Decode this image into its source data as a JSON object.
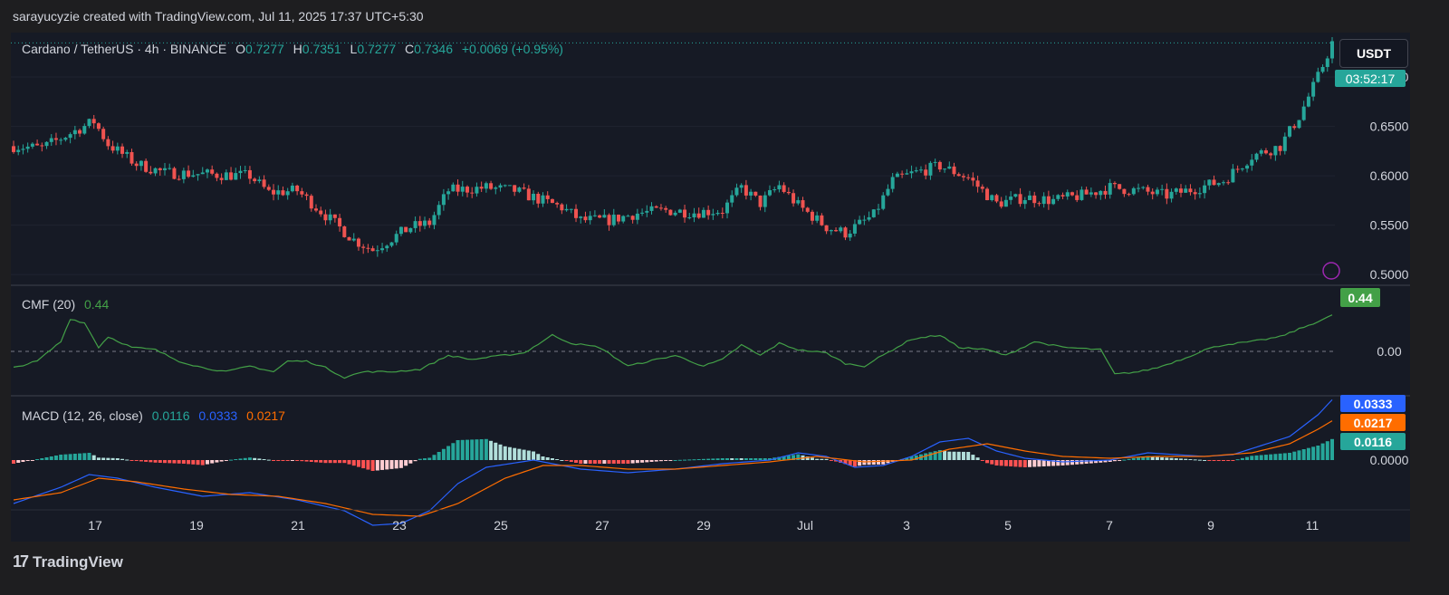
{
  "header": {
    "text": "sarayucyzie created with TradingView.com, Jul 11, 2025 17:37 UTC+5:30"
  },
  "footer": {
    "brand": "TradingView",
    "logo": "tv-logo-icon"
  },
  "symbol": {
    "name": "Cardano / TetherUS · 4h · BINANCE",
    "o_label": "O",
    "o": "0.7277",
    "h_label": "H",
    "h": "0.7351",
    "l_label": "L",
    "l": "0.7277",
    "c_label": "C",
    "c": "0.7346",
    "change": "+0.0069 (+0.95%)"
  },
  "currency_button": "USDT",
  "countdown": "03:52:17",
  "cmf": {
    "title": "CMF (20)",
    "value": "0.44"
  },
  "macd": {
    "title": "MACD (12, 26, close)",
    "histogram": "0.0116",
    "macd": "0.0333",
    "signal": "0.0217"
  },
  "colors": {
    "bg": "#161a25",
    "up": "#26a69a",
    "down": "#ef5350",
    "cmf": "#43a047",
    "macd": "#2962ff",
    "signal": "#ff6d00",
    "hist_up_strong": "#26a69a",
    "hist_up_weak": "#b2dfdb",
    "hist_down_strong": "#ff5252",
    "hist_down_weak": "#ffcdd2"
  },
  "chart_data": {
    "type": "candlestick",
    "price_axis": {
      "ticks": [
        "0.7000",
        "0.6500",
        "0.6000",
        "0.5500",
        "0.5000"
      ],
      "ylim": [
        0.49,
        0.745
      ]
    },
    "x_ticks": [
      "17",
      "19",
      "21",
      "23",
      "25",
      "27",
      "29",
      "Jul",
      "3",
      "5",
      "7",
      "9",
      "11"
    ],
    "last_price": 0.7346,
    "close_anchors": [
      [
        0,
        0.63
      ],
      [
        6,
        0.628
      ],
      [
        14,
        0.648
      ],
      [
        17,
        0.655
      ],
      [
        20,
        0.632
      ],
      [
        26,
        0.612
      ],
      [
        32,
        0.603
      ],
      [
        38,
        0.602
      ],
      [
        44,
        0.601
      ],
      [
        50,
        0.6
      ],
      [
        54,
        0.583
      ],
      [
        60,
        0.585
      ],
      [
        66,
        0.56
      ],
      [
        72,
        0.535
      ],
      [
        76,
        0.525
      ],
      [
        84,
        0.548
      ],
      [
        88,
        0.552
      ],
      [
        92,
        0.585
      ],
      [
        100,
        0.588
      ],
      [
        106,
        0.585
      ],
      [
        110,
        0.578
      ],
      [
        116,
        0.568
      ],
      [
        120,
        0.555
      ],
      [
        126,
        0.555
      ],
      [
        132,
        0.562
      ],
      [
        138,
        0.565
      ],
      [
        144,
        0.563
      ],
      [
        150,
        0.565
      ],
      [
        154,
        0.588
      ],
      [
        158,
        0.572
      ],
      [
        162,
        0.59
      ],
      [
        166,
        0.57
      ],
      [
        172,
        0.548
      ],
      [
        176,
        0.542
      ],
      [
        182,
        0.56
      ],
      [
        186,
        0.595
      ],
      [
        190,
        0.602
      ],
      [
        196,
        0.61
      ],
      [
        202,
        0.598
      ],
      [
        208,
        0.572
      ],
      [
        214,
        0.578
      ],
      [
        220,
        0.575
      ],
      [
        226,
        0.58
      ],
      [
        232,
        0.588
      ],
      [
        238,
        0.585
      ],
      [
        244,
        0.58
      ],
      [
        250,
        0.587
      ],
      [
        256,
        0.595
      ],
      [
        262,
        0.62
      ],
      [
        268,
        0.63
      ],
      [
        272,
        0.66
      ],
      [
        276,
        0.7
      ],
      [
        279,
        0.7346
      ]
    ],
    "cmf_series": {
      "name": "CMF (20)",
      "last": 0.44,
      "zero_line": 0,
      "anchors": [
        [
          0,
          -0.2
        ],
        [
          5,
          -0.12
        ],
        [
          10,
          0.12
        ],
        [
          12,
          0.4
        ],
        [
          15,
          0.35
        ],
        [
          18,
          0.05
        ],
        [
          20,
          0.18
        ],
        [
          25,
          0.05
        ],
        [
          30,
          0.02
        ],
        [
          35,
          -0.12
        ],
        [
          40,
          -0.2
        ],
        [
          45,
          -0.25
        ],
        [
          50,
          -0.18
        ],
        [
          55,
          -0.25
        ],
        [
          58,
          -0.12
        ],
        [
          62,
          -0.12
        ],
        [
          66,
          -0.2
        ],
        [
          70,
          -0.32
        ],
        [
          74,
          -0.25
        ],
        [
          80,
          -0.25
        ],
        [
          86,
          -0.22
        ],
        [
          92,
          -0.05
        ],
        [
          97,
          -0.1
        ],
        [
          102,
          -0.06
        ],
        [
          108,
          -0.02
        ],
        [
          114,
          0.2
        ],
        [
          118,
          0.1
        ],
        [
          124,
          0.05
        ],
        [
          130,
          -0.18
        ],
        [
          136,
          -0.1
        ],
        [
          140,
          -0.05
        ],
        [
          146,
          -0.18
        ],
        [
          150,
          -0.1
        ],
        [
          154,
          0.08
        ],
        [
          158,
          -0.05
        ],
        [
          162,
          0.1
        ],
        [
          166,
          0.02
        ],
        [
          172,
          -0.02
        ],
        [
          176,
          -0.15
        ],
        [
          180,
          -0.18
        ],
        [
          186,
          0.02
        ],
        [
          190,
          0.15
        ],
        [
          196,
          0.2
        ],
        [
          200,
          0.05
        ],
        [
          206,
          0.02
        ],
        [
          210,
          -0.05
        ],
        [
          216,
          0.12
        ],
        [
          222,
          0.05
        ],
        [
          230,
          0.02
        ],
        [
          233,
          -0.28
        ],
        [
          238,
          -0.25
        ],
        [
          242,
          -0.2
        ],
        [
          248,
          -0.08
        ],
        [
          252,
          0.02
        ],
        [
          256,
          0.08
        ],
        [
          262,
          0.12
        ],
        [
          268,
          0.18
        ],
        [
          274,
          0.32
        ],
        [
          279,
          0.44
        ]
      ]
    },
    "macd_series": {
      "macd_anchors": [
        [
          0,
          -0.024
        ],
        [
          10,
          -0.015
        ],
        [
          16,
          -0.008
        ],
        [
          22,
          -0.01
        ],
        [
          30,
          -0.015
        ],
        [
          40,
          -0.02
        ],
        [
          50,
          -0.018
        ],
        [
          60,
          -0.022
        ],
        [
          70,
          -0.028
        ],
        [
          76,
          -0.036
        ],
        [
          82,
          -0.035
        ],
        [
          88,
          -0.028
        ],
        [
          94,
          -0.013
        ],
        [
          100,
          -0.004
        ],
        [
          110,
          0.0
        ],
        [
          120,
          -0.005
        ],
        [
          130,
          -0.007
        ],
        [
          140,
          -0.005
        ],
        [
          150,
          -0.002
        ],
        [
          160,
          0.0
        ],
        [
          166,
          0.004
        ],
        [
          172,
          0.002
        ],
        [
          178,
          -0.004
        ],
        [
          184,
          -0.003
        ],
        [
          190,
          0.002
        ],
        [
          196,
          0.01
        ],
        [
          202,
          0.012
        ],
        [
          208,
          0.005
        ],
        [
          214,
          0.001
        ],
        [
          222,
          -0.001
        ],
        [
          232,
          0.0
        ],
        [
          240,
          0.004
        ],
        [
          246,
          0.003
        ],
        [
          252,
          0.002
        ],
        [
          258,
          0.003
        ],
        [
          264,
          0.008
        ],
        [
          270,
          0.013
        ],
        [
          276,
          0.025
        ],
        [
          279,
          0.0333
        ]
      ],
      "signal_anchors": [
        [
          0,
          -0.022
        ],
        [
          10,
          -0.018
        ],
        [
          18,
          -0.01
        ],
        [
          26,
          -0.012
        ],
        [
          36,
          -0.016
        ],
        [
          46,
          -0.019
        ],
        [
          56,
          -0.02
        ],
        [
          66,
          -0.024
        ],
        [
          76,
          -0.03
        ],
        [
          86,
          -0.031
        ],
        [
          94,
          -0.024
        ],
        [
          104,
          -0.01
        ],
        [
          112,
          -0.003
        ],
        [
          120,
          -0.003
        ],
        [
          130,
          -0.005
        ],
        [
          140,
          -0.005
        ],
        [
          150,
          -0.003
        ],
        [
          160,
          -0.001
        ],
        [
          170,
          0.002
        ],
        [
          180,
          -0.001
        ],
        [
          190,
          0.0
        ],
        [
          198,
          0.006
        ],
        [
          206,
          0.009
        ],
        [
          214,
          0.005
        ],
        [
          222,
          0.002
        ],
        [
          232,
          0.001
        ],
        [
          242,
          0.002
        ],
        [
          252,
          0.002
        ],
        [
          262,
          0.004
        ],
        [
          270,
          0.009
        ],
        [
          276,
          0.017
        ],
        [
          279,
          0.0217
        ]
      ],
      "ylim": [
        -0.041,
        0.044
      ],
      "ticks": [
        "0.0000"
      ]
    }
  }
}
